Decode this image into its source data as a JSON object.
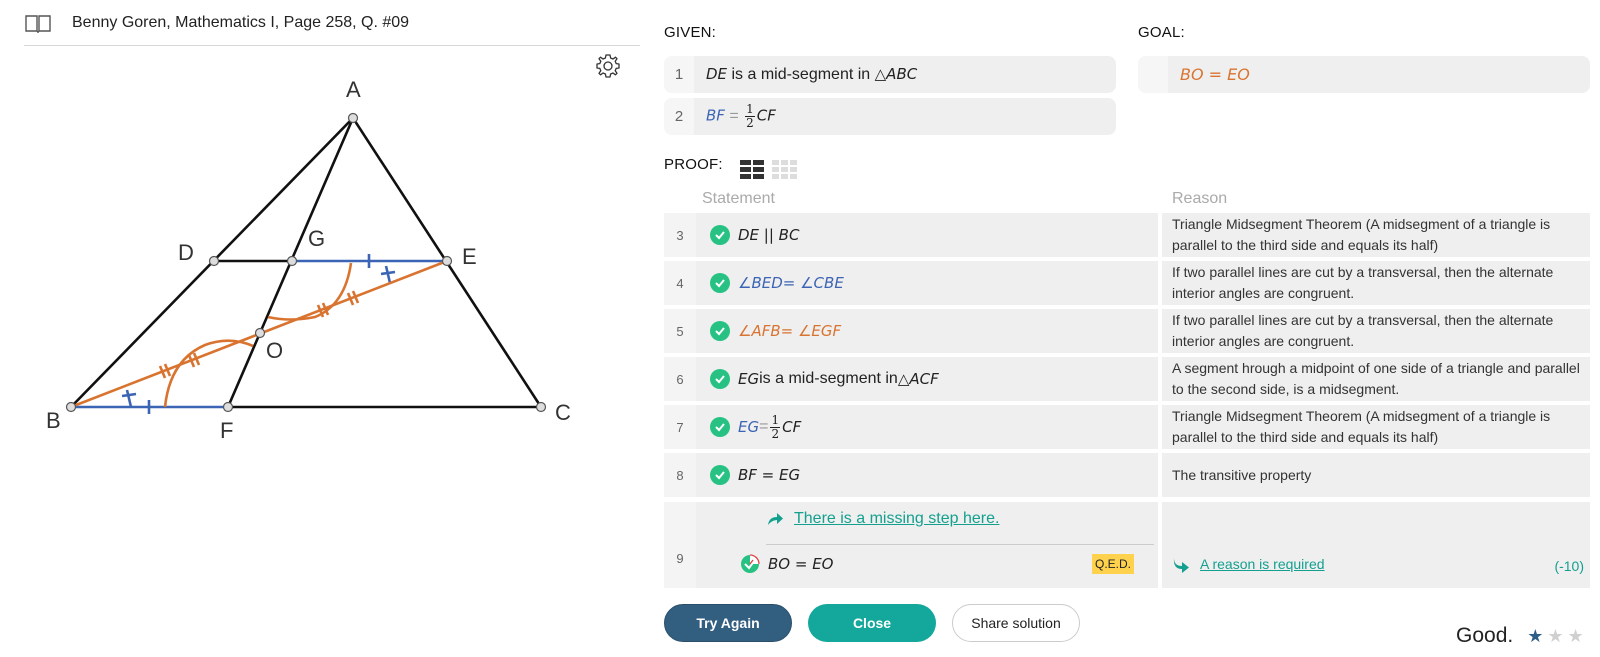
{
  "header": {
    "title": "Benny Goren, Mathematics I, Page 258, Q. #09",
    "book_icon": "book-icon",
    "settings_icon": "gear-icon"
  },
  "diagram": {
    "points": {
      "A": "A",
      "B": "B",
      "C": "C",
      "D": "D",
      "E": "E",
      "F": "F",
      "G": "G",
      "O": "O"
    },
    "colors": {
      "lines": "#111111",
      "blue": "#3c64b4",
      "orange": "#d97430",
      "point_fill": "#dddddd"
    }
  },
  "given": {
    "label": "GIVEN:",
    "items": [
      {
        "num": "1",
        "seg": "DE",
        "text": " is a mid-segment in ",
        "tri": "△ABC"
      },
      {
        "num": "2",
        "lhs": "BF",
        "eq": " = ",
        "frac_num": "1",
        "frac_den": "2",
        "rhs": "CF"
      }
    ]
  },
  "goal": {
    "label": "GOAL:",
    "text": "BO = EO"
  },
  "proof": {
    "label": "PROOF:",
    "view_icons": [
      "two-column-grid-icon",
      "three-column-grid-icon"
    ],
    "statement_header": "Statement",
    "reason_header": "Reason",
    "rows": [
      {
        "num": "3",
        "statement": "DE || BC",
        "reason": "Triangle Midsegment Theorem (A midsegment of a triangle is parallel to the third side and equals its half)"
      },
      {
        "num": "4",
        "statement": "∠BED= ∠CBE",
        "reason": "If two parallel lines are cut by a transversal, then the alternate interior angles are congruent."
      },
      {
        "num": "5",
        "statement": "∠AFB= ∠EGF",
        "reason": "If two parallel lines are cut by a transversal, then the alternate interior angles are congruent."
      },
      {
        "num": "6",
        "seg": "EG",
        "text": " is a mid-segment in ",
        "tri": "△ACF",
        "reason": "A segment hrough a midpoint of one side of a triangle and parallel to the second side, is a midsegment."
      },
      {
        "num": "7",
        "lhs": "EG",
        "eq": " = ",
        "frac_num": "1",
        "frac_den": "2",
        "rhs": "CF",
        "reason": "Triangle Midsegment Theorem (A midsegment of a triangle is parallel to the third side and equals its half)"
      },
      {
        "num": "8",
        "statement": "BF = EG",
        "reason": "The transitive property"
      },
      {
        "num": "9",
        "statement": "BO = EO",
        "missing_step": "There is a missing step here.",
        "qed": "Q.E.D.",
        "reason_link": "A reason is required",
        "penalty": "(-10)"
      }
    ]
  },
  "buttons": {
    "try_again": "Try Again",
    "close": "Close",
    "share": "Share solution"
  },
  "rating": {
    "text": "Good.",
    "stars_filled": 1,
    "stars_total": 3,
    "star_filled_color": "#2e5f88",
    "star_empty_color": "#d0d0d0"
  }
}
